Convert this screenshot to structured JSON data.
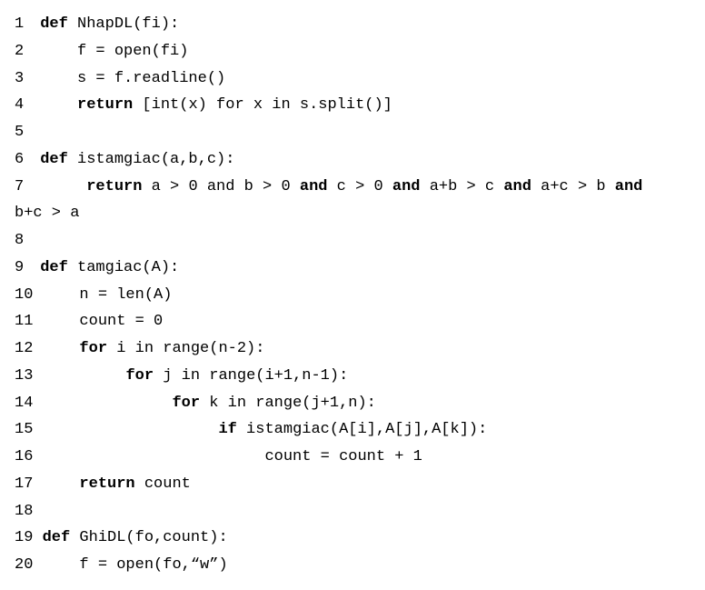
{
  "code": {
    "lines": [
      {
        "num": "1",
        "indent": " ",
        "parts": [
          {
            "t": "kw",
            "v": "def"
          },
          {
            "t": "",
            "v": " NhapDL(fi):"
          }
        ]
      },
      {
        "num": "2",
        "indent": "     ",
        "parts": [
          {
            "t": "",
            "v": "f = open(fi)"
          }
        ]
      },
      {
        "num": "3",
        "indent": "     ",
        "parts": [
          {
            "t": "",
            "v": "s = f.readline()"
          }
        ]
      },
      {
        "num": "4",
        "indent": "     ",
        "parts": [
          {
            "t": "kw",
            "v": "return"
          },
          {
            "t": "",
            "v": " [int(x) for x in s.split()]"
          }
        ]
      },
      {
        "num": "5",
        "indent": "",
        "parts": []
      },
      {
        "num": "6",
        "indent": " ",
        "parts": [
          {
            "t": "kw",
            "v": "def"
          },
          {
            "t": "",
            "v": " istamgiac(a,b,c):"
          }
        ]
      },
      {
        "num": "7",
        "indent": "      ",
        "parts": [
          {
            "t": "kw",
            "v": "return"
          },
          {
            "t": "",
            "v": " a > 0 and b > 0 "
          },
          {
            "t": "kw",
            "v": "and"
          },
          {
            "t": "",
            "v": " c > 0 "
          },
          {
            "t": "kw",
            "v": "and"
          },
          {
            "t": "",
            "v": " a+b > c "
          },
          {
            "t": "kw",
            "v": "and"
          },
          {
            "t": "",
            "v": " a+c > b "
          },
          {
            "t": "kw",
            "v": "and"
          }
        ],
        "wrap": "b+c > a"
      },
      {
        "num": "8",
        "indent": "",
        "parts": []
      },
      {
        "num": "9",
        "indent": " ",
        "parts": [
          {
            "t": "kw",
            "v": "def"
          },
          {
            "t": "",
            "v": " tamgiac(A):"
          }
        ]
      },
      {
        "num": "10",
        "indent": "     ",
        "parts": [
          {
            "t": "",
            "v": "n = len(A)"
          }
        ]
      },
      {
        "num": "11",
        "indent": "     ",
        "parts": [
          {
            "t": "",
            "v": "count = 0"
          }
        ]
      },
      {
        "num": "12",
        "indent": "     ",
        "parts": [
          {
            "t": "kw",
            "v": "for"
          },
          {
            "t": "",
            "v": " i in range(n-2):"
          }
        ]
      },
      {
        "num": "13",
        "indent": "          ",
        "parts": [
          {
            "t": "kw",
            "v": "for"
          },
          {
            "t": "",
            "v": " j in range(i+1,n-1):"
          }
        ]
      },
      {
        "num": "14",
        "indent": "               ",
        "parts": [
          {
            "t": "kw",
            "v": "for"
          },
          {
            "t": "",
            "v": " k in range(j+1,n):"
          }
        ]
      },
      {
        "num": "15",
        "indent": "                    ",
        "parts": [
          {
            "t": "kw",
            "v": "if"
          },
          {
            "t": "",
            "v": " istamgiac(A[i],A[j],A[k]):"
          }
        ]
      },
      {
        "num": "16",
        "indent": "                         ",
        "parts": [
          {
            "t": "",
            "v": "count = count + 1"
          }
        ]
      },
      {
        "num": "17",
        "indent": "     ",
        "parts": [
          {
            "t": "kw",
            "v": "return"
          },
          {
            "t": "",
            "v": " count"
          }
        ]
      },
      {
        "num": "18",
        "indent": "",
        "parts": []
      },
      {
        "num": "19",
        "indent": " ",
        "parts": [
          {
            "t": "kw",
            "v": "def"
          },
          {
            "t": "",
            "v": " GhiDL(fo,count):"
          }
        ]
      },
      {
        "num": "20",
        "indent": "     ",
        "parts": [
          {
            "t": "",
            "v": "f = open(fo,“w”)"
          }
        ]
      }
    ]
  }
}
